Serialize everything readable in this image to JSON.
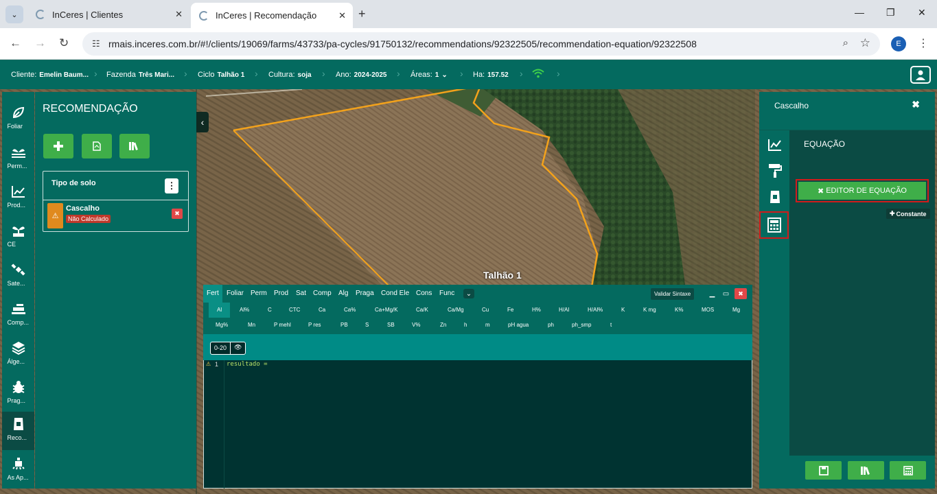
{
  "browser": {
    "tabs": [
      {
        "title": "InCeres | Clientes"
      },
      {
        "title": "InCeres | Recomendação"
      }
    ],
    "url": "rmais.inceres.com.br/#!/clients/19069/farms/43733/pa-cycles/91750132/recommendations/92322505/recommendation-equation/92322508",
    "profile_initial": "E"
  },
  "header": {
    "cliente_label": "Cliente:",
    "cliente_value": "Emelin Baum...",
    "fazenda_label": "Fazenda",
    "fazenda_value": "Três Mari...",
    "ciclo_label": "Ciclo",
    "ciclo_value": "Talhão 1",
    "cultura_label": "Cultura:",
    "cultura_value": "soja",
    "ano_label": "Ano:",
    "ano_value": "2024-2025",
    "areas_label": "Áreas:",
    "areas_value": "1",
    "ha_label": "Ha:",
    "ha_value": "157.52"
  },
  "leftnav": [
    {
      "label": "Foliar",
      "icon": "leaf-icon"
    },
    {
      "label": "Perm...",
      "icon": "plant-icon"
    },
    {
      "label": "Prod...",
      "icon": "chart-icon"
    },
    {
      "label": "CE",
      "icon": "sprout-icon"
    },
    {
      "label": "Sate...",
      "icon": "satellite-icon"
    },
    {
      "label": "Comp...",
      "icon": "tractor-icon"
    },
    {
      "label": "Álge...",
      "icon": "layers-icon"
    },
    {
      "label": "Prag...",
      "icon": "bug-icon"
    },
    {
      "label": "Reco...",
      "icon": "bag-icon"
    },
    {
      "label": "As Ap...",
      "icon": "sprayer-icon"
    }
  ],
  "left_panel": {
    "title": "RECOMENDAÇÃO",
    "soil_header": "Tipo de solo",
    "soil_item": {
      "name": "Cascalho",
      "status": "Não Calculado"
    }
  },
  "map": {
    "field_label": "Talhão 1"
  },
  "editor": {
    "tabs": [
      "Fert",
      "Foliar",
      "Perm",
      "Prod",
      "Sat",
      "Comp",
      "Alg",
      "Praga",
      "Cond Ele",
      "Cons",
      "Func"
    ],
    "validate_label": "Validar Sintaxe",
    "vars_row1": [
      "Al",
      "Al%",
      "C",
      "CTC",
      "Ca",
      "Ca%",
      "Ca+Mg/K",
      "Ca/K",
      "Ca/Mg",
      "Cu",
      "Fe",
      "H%",
      "H/Al",
      "H/Al%",
      "K",
      "K mg",
      "K%",
      "MOS",
      "Mg"
    ],
    "vars_row2": [
      "Mg%",
      "Mn",
      "P mehl",
      "P res",
      "PB",
      "S",
      "SB",
      "V%",
      "Zn",
      "h",
      "m",
      "pH agua",
      "ph",
      "ph_smp",
      "t"
    ],
    "depth": "0-20",
    "line_number": "1",
    "code": "resultado ="
  },
  "right_panel": {
    "title": "Cascalho",
    "section": "EQUAÇÃO",
    "editor_button": "EDITOR DE EQUAÇÃO",
    "constant_button": "Constante"
  },
  "colors": {
    "primary": "#046a5f",
    "dark": "#0b4b44",
    "accent_green": "#3fae49",
    "danger": "#e04848",
    "highlight": "#d21b1b"
  }
}
